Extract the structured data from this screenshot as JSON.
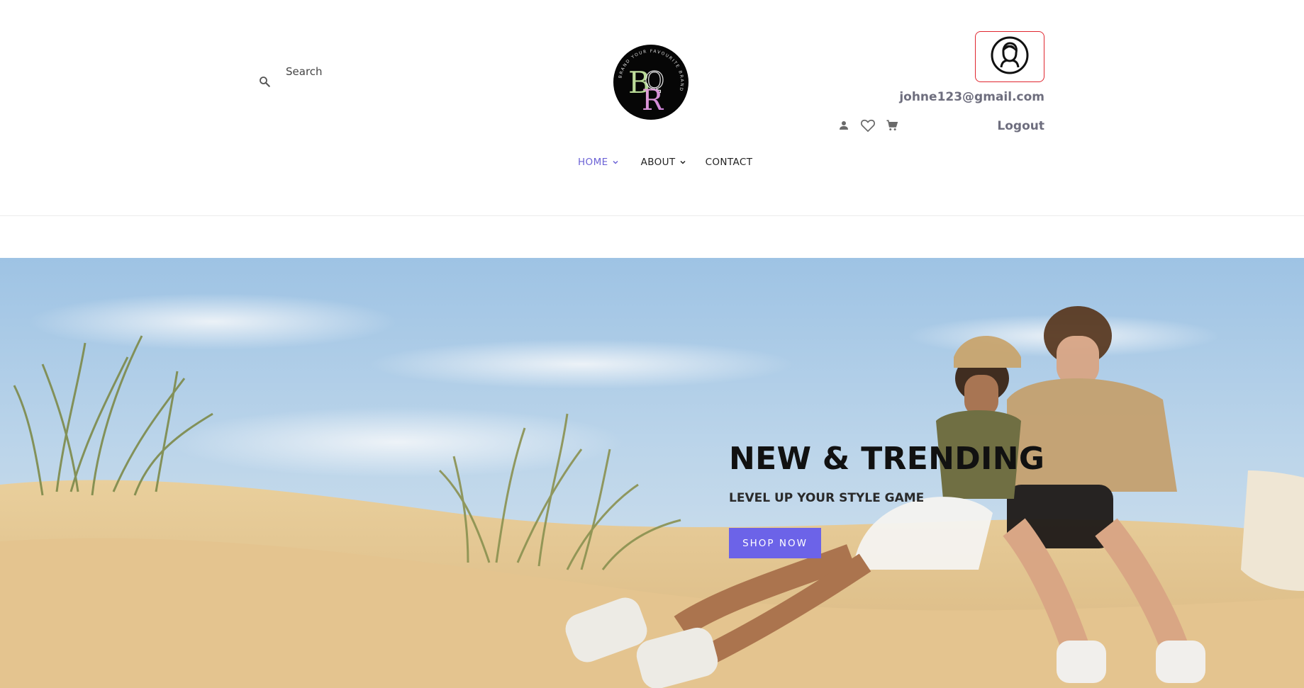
{
  "search": {
    "placeholder": "Search",
    "icon": "search-icon"
  },
  "brand": {
    "logo_letters": "BQR",
    "logo_ring_text": "BRAND YOUR FAVOURITE BRAND"
  },
  "account": {
    "email": "johne123@gmail.com",
    "logout_label": "Logout",
    "avatar_icon": "user-avatar-icon"
  },
  "header_icons": [
    "user-icon",
    "heart-icon",
    "cart-icon"
  ],
  "nav": {
    "items": [
      {
        "label": "HOME",
        "has_dropdown": true,
        "active": true
      },
      {
        "label": "ABOUT",
        "has_dropdown": true,
        "active": false
      },
      {
        "label": "CONTACT",
        "has_dropdown": false,
        "active": false
      }
    ]
  },
  "hero": {
    "title": "NEW & TRENDING",
    "subtitle": "LEVEL UP YOUR STYLE GAME",
    "cta_label": "SHOP NOW"
  },
  "colors": {
    "accent": "#6c63e8",
    "nav_active": "#6c63d6",
    "avatar_border": "#e0262f",
    "account_text": "#6e6e7e"
  }
}
